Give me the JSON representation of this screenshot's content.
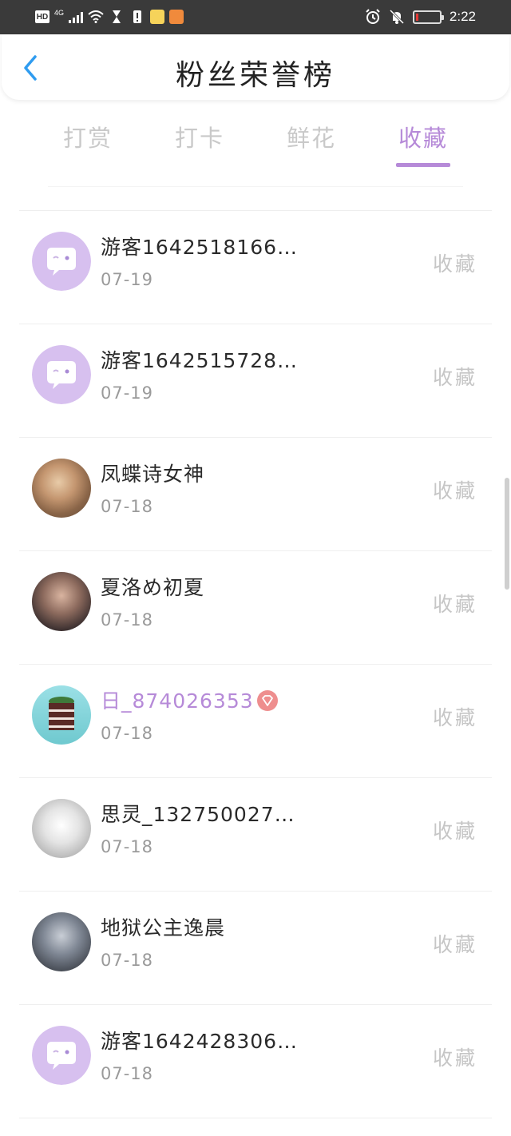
{
  "status_bar": {
    "hd": "HD",
    "network": "4G",
    "time": "2:22",
    "battery_level": 0.1,
    "battery_color": "#e53935"
  },
  "header": {
    "title": "粉丝荣誉榜",
    "back_icon": "chevron-left-icon"
  },
  "tabs": [
    {
      "label": "打赏",
      "active": false
    },
    {
      "label": "打卡",
      "active": false
    },
    {
      "label": "鲜花",
      "active": false
    },
    {
      "label": "收藏",
      "active": true
    }
  ],
  "accent_color": "#b68ad8",
  "list": [
    {
      "name": "游客1642518166…",
      "date": "07-19",
      "action": "收藏",
      "avatar": "guest-avatar"
    },
    {
      "name": "游客1642515728…",
      "date": "07-19",
      "action": "收藏",
      "avatar": "guest-avatar"
    },
    {
      "name": "凤蝶诗女神",
      "date": "07-18",
      "action": "收藏",
      "avatar": "user-photo"
    },
    {
      "name": "夏洛め初夏",
      "date": "07-18",
      "action": "收藏",
      "avatar": "user-photo"
    },
    {
      "name": "日_874026353",
      "date": "07-18",
      "action": "收藏",
      "avatar": "cake-photo",
      "vip": true
    },
    {
      "name": "思灵_132750027…",
      "date": "07-18",
      "action": "收藏",
      "avatar": "sketch-photo"
    },
    {
      "name": "地狱公主逸晨",
      "date": "07-18",
      "action": "收藏",
      "avatar": "user-photo"
    },
    {
      "name": "游客1642428306…",
      "date": "07-18",
      "action": "收藏",
      "avatar": "guest-avatar"
    }
  ]
}
